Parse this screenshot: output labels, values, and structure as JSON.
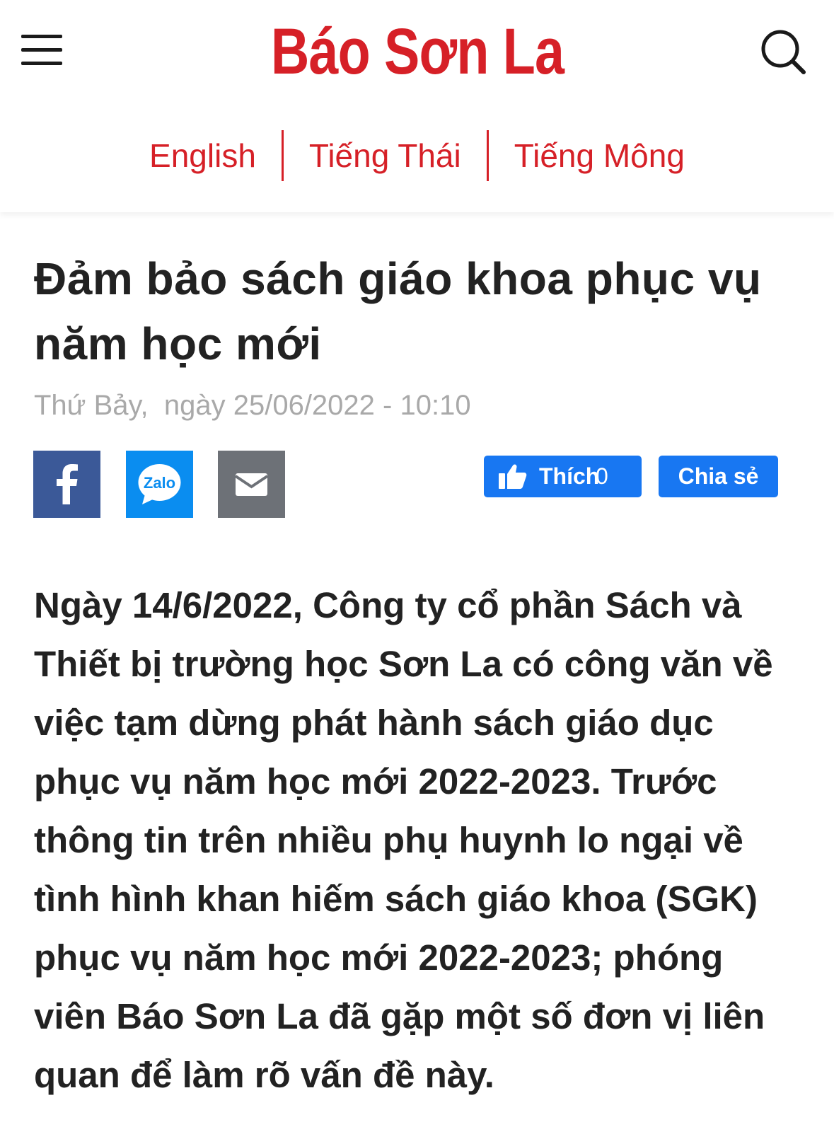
{
  "header": {
    "logo_text": "Báo Sơn La",
    "menu_icon": "hamburger-menu-icon",
    "search_icon": "search-icon",
    "languages": [
      "English",
      "Tiếng Thái",
      "Tiếng Mông"
    ]
  },
  "article": {
    "title": "Đảm bảo sách giáo khoa phục vụ năm học mới",
    "dateline": "Thứ Bảy,  ngày 25/06/2022 - 10:10",
    "share_icons": [
      "facebook-icon",
      "zalo-icon",
      "email-icon"
    ],
    "zalo_text": "Zalo",
    "like_label": "Thích",
    "like_count": "0",
    "share_label": "Chia sẻ",
    "lead": "Ngày 14/6/2022, Công ty cổ phần Sách và Thiết bị trường học Sơn La có công văn về việc tạm dừng phát hành sách giáo dục phục vụ năm học mới 2022-2023. Trước thông tin trên nhiều phụ huynh lo ngại về tình hình khan hiếm sách giáo khoa (SGK) phục vụ năm học mới 2022-2023; phóng viên Báo Sơn La đã gặp một số đơn vị liên quan để làm rõ vấn đề này."
  },
  "colors": {
    "brand_red": "#d62027",
    "facebook_blue": "#3b5998",
    "zalo_blue": "#0a8df0",
    "email_gray": "#6d7177",
    "fb_button_blue": "#1877f2",
    "dateline_gray": "#a9a9a9",
    "text_dark": "#222222"
  }
}
